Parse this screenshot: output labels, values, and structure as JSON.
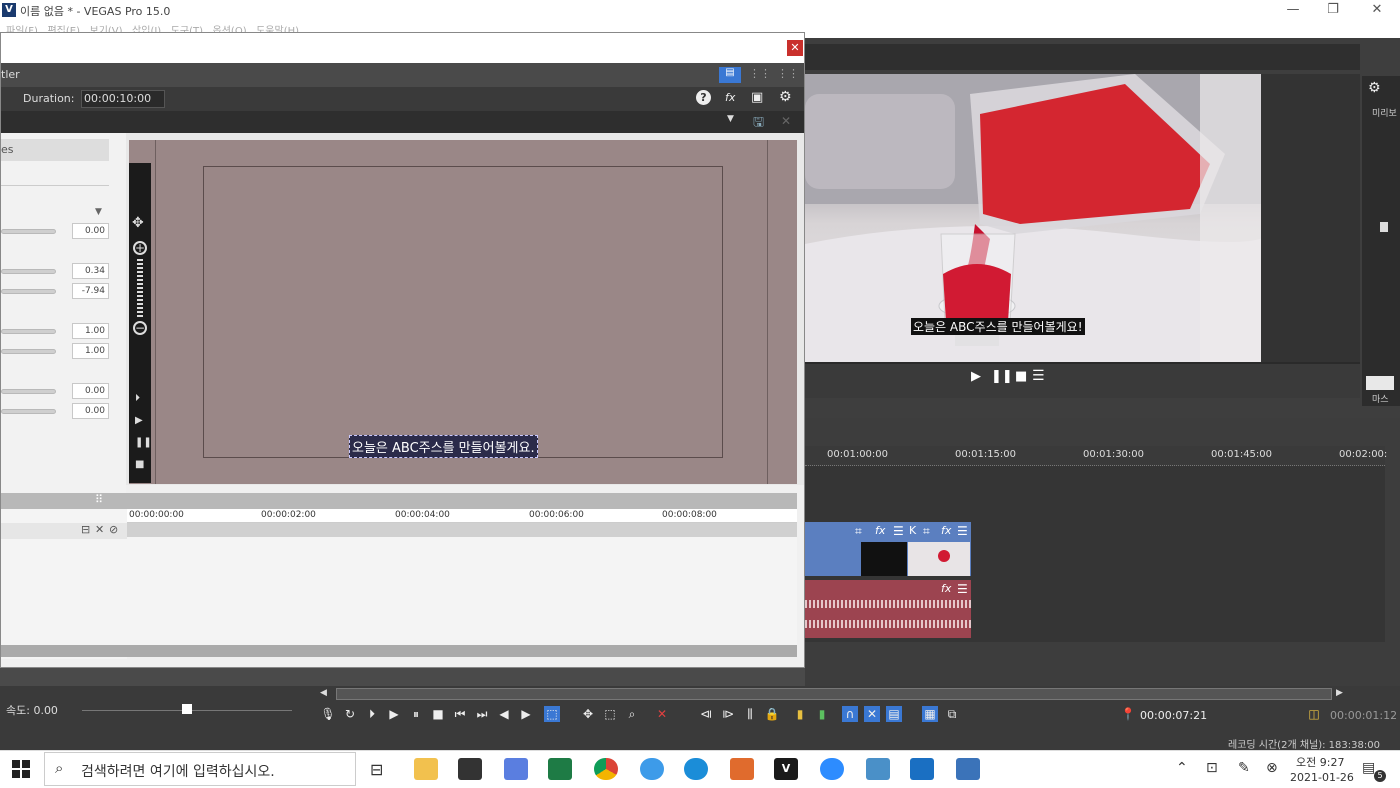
{
  "app": {
    "logo": "V",
    "title": "이름 없음 * - VEGAS Pro 15.0",
    "menu": [
      "파일(F)",
      "편집(E)",
      "보기(V)",
      "삽입(I)",
      "도구(T)",
      "옵션(O)",
      "도움말(H)"
    ],
    "min": "—",
    "max": "❐",
    "close": "✕"
  },
  "dialog": {
    "close": "✕",
    "header_label": "tler",
    "duration_label": "Duration:",
    "duration_value": "00:00:10:00",
    "panel_tab": "es",
    "values": [
      "0.00",
      "0.34",
      "-7.94",
      "1.00",
      "1.00",
      "0.00",
      "0.00"
    ],
    "canvas_text": "오늘은 ABC주스를 만들어볼게요.",
    "ruler": [
      "00:00:00:00",
      "00:00:02:00",
      "00:00:04:00",
      "00:00:06:00",
      "00:00:08:00"
    ]
  },
  "preview": {
    "subtitle": "오늘은 ABC주스를 만들어볼게요!",
    "side_label": "미리보",
    "side_label2": "마스"
  },
  "timeline": {
    "ruler": [
      "00:01:00:00",
      "00:01:15:00",
      "00:01:30:00",
      "00:01:45:00",
      "00:02:00:"
    ],
    "rate_label": "속도: 0.00",
    "time_cursor": "00:00:07:21",
    "time_end": "00:00:01:12",
    "record_status": "레코딩 시간(2개 채널): 183:38:00"
  },
  "taskbar": {
    "search_placeholder": "검색하려면 여기에 입력하십시오.",
    "clock_ampm": "오전 9:27",
    "date": "2021-01-26",
    "notif_count": "5"
  },
  "colors": {
    "accent": "#3a78d4",
    "canvas": "#9a8787",
    "video_track": "#5b7fc0",
    "audio_track": "#9c4450"
  }
}
